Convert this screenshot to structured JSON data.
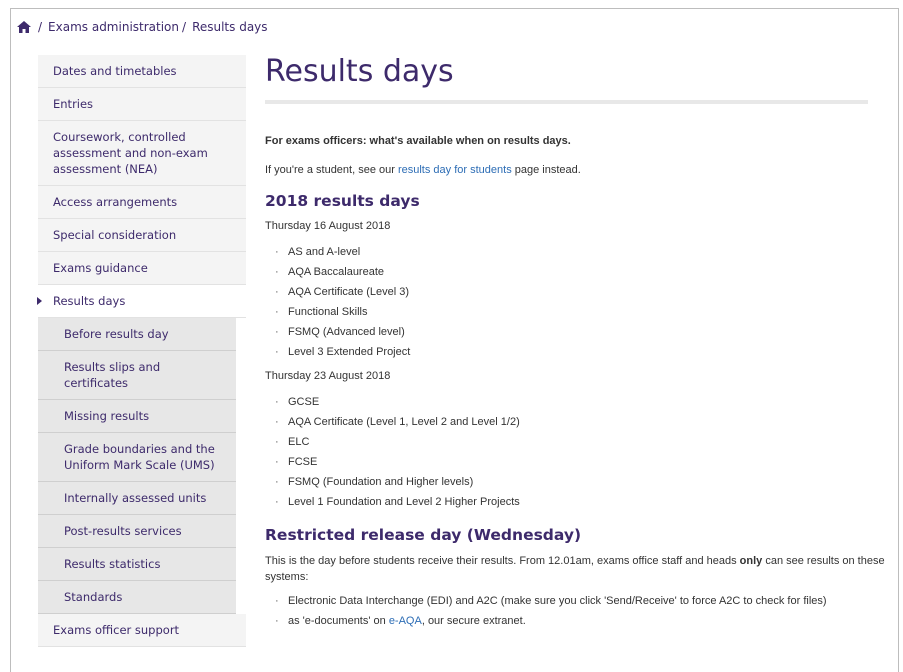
{
  "breadcrumb": {
    "home_icon": "home-icon",
    "sep": "/",
    "items": [
      "Exams administration",
      "Results days"
    ]
  },
  "sidebar": {
    "items": [
      "Dates and timetables",
      "Entries",
      "Coursework, controlled assessment and non-exam assessment (NEA)",
      "Access arrangements",
      "Special consideration",
      "Exams guidance"
    ],
    "active": "Results days",
    "subitems": [
      "Before results day",
      "Results slips and certificates",
      "Missing results",
      "Grade boundaries and the Uniform Mark Scale (UMS)",
      "Internally assessed units",
      "Post-results services",
      "Results statistics",
      "Standards"
    ],
    "last": "Exams officer support"
  },
  "main": {
    "title": "Results days",
    "intro": "For exams officers: what's available when on results days.",
    "student_pre": "If you're a student, see our ",
    "student_link": "results day for students",
    "student_post": " page instead.",
    "h2_2018": "2018 results days",
    "date1": "Thursday 16 August 2018",
    "list1": [
      "AS and A-level",
      "AQA Baccalaureate",
      "AQA Certificate (Level 3)",
      "Functional Skills",
      "FSMQ (Advanced level)",
      "Level 3 Extended Project"
    ],
    "date2": "Thursday 23 August 2018",
    "list2": [
      "GCSE",
      "AQA Certificate (Level 1, Level 2 and Level 1/2)",
      "ELC",
      "FCSE",
      "FSMQ (Foundation and Higher levels)",
      "Level 1 Foundation and Level 2 Higher Projects"
    ],
    "h2_restricted": "Restricted release day (Wednesday)",
    "restricted_p1": "This is the day before students receive their results. From 12.01am, exams office staff and heads ",
    "restricted_bold": "only",
    "restricted_p2": " can see results on these systems:",
    "systems_item1": "Electronic Data Interchange (EDI) and A2C (make sure you click 'Send/Receive' to force A2C to check for files)",
    "systems_item2_pre": "as 'e-documents' on ",
    "systems_item2_link": "e-AQA",
    "systems_item2_post": ", our secure extranet.",
    "bullet": "·"
  }
}
